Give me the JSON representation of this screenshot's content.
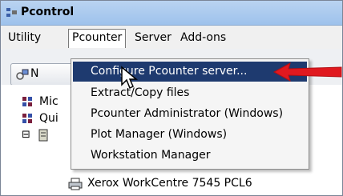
{
  "window": {
    "title": "Pcontrol"
  },
  "menu": {
    "items": [
      "Utility",
      "Pcounter",
      "Server",
      "Add-ons"
    ]
  },
  "toolbar": {
    "button_label": "N"
  },
  "dropdown": {
    "items": [
      "Configure Pcounter server...",
      "Extract/Copy files",
      "Pcounter Administrator (Windows)",
      "Plot Manager (Windows)",
      "Workstation Manager"
    ],
    "highlighted_index": 0
  },
  "tree": {
    "nodes": [
      "Mic",
      "Qui",
      "Xerox WorkCentre 7545 PCL6"
    ],
    "expander": "⊟"
  },
  "colors": {
    "highlight": "#1e3a6f",
    "arrow": "#e0191f"
  }
}
